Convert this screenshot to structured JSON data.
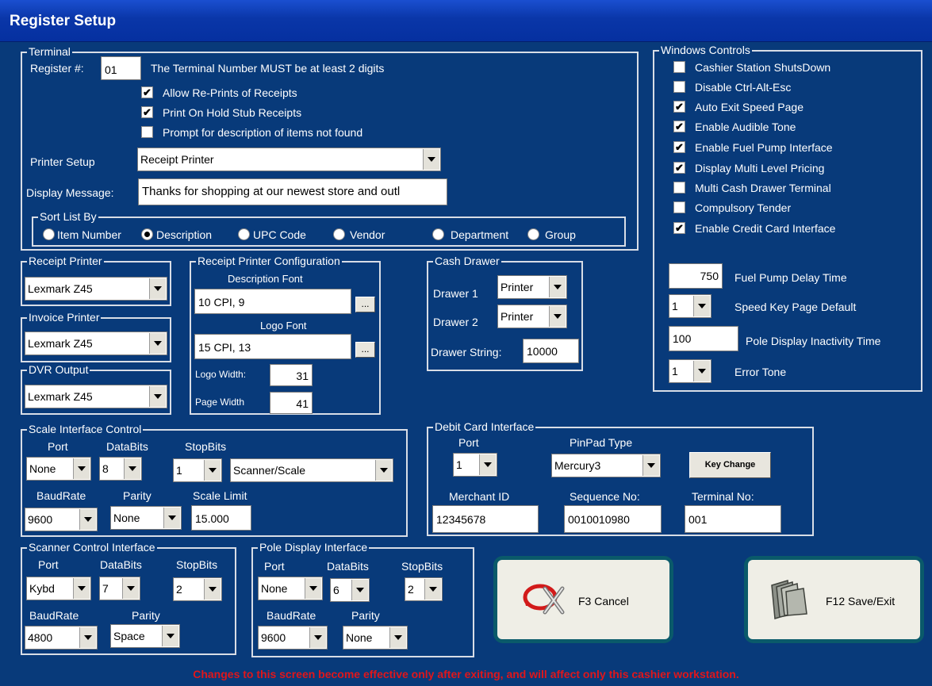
{
  "window": {
    "title": "Register Setup"
  },
  "terminal": {
    "legend": "Terminal",
    "register_label": "Register #:",
    "register_value": "01",
    "register_note": "The Terminal Number MUST be at least 2 digits",
    "options": [
      {
        "label": "Allow Re-Prints of Receipts",
        "checked": true
      },
      {
        "label": "Print On Hold Stub Receipts",
        "checked": true
      },
      {
        "label": "Prompt for description of items not found",
        "checked": false
      }
    ],
    "printer_setup_label": "Printer Setup",
    "printer_setup_value": "Receipt Printer",
    "display_message_label": "Display Message:",
    "display_message_value": "Thanks for shopping at our newest store and outl"
  },
  "sort_list": {
    "legend": "Sort List By",
    "options": [
      "Item Number",
      "Description",
      "UPC Code",
      "Vendor",
      "Department",
      "Group"
    ],
    "selected": "Description"
  },
  "windows_controls": {
    "legend": "Windows Controls",
    "items": [
      {
        "label": "Cashier Station ShutsDown",
        "checked": false
      },
      {
        "label": "Disable Ctrl-Alt-Esc",
        "checked": false
      },
      {
        "label": "Auto Exit Speed Page",
        "checked": true
      },
      {
        "label": "Enable Audible Tone",
        "checked": true
      },
      {
        "label": "Enable Fuel Pump Interface",
        "checked": true
      },
      {
        "label": "Display Multi Level Pricing",
        "checked": true
      },
      {
        "label": "Multi Cash Drawer Terminal",
        "checked": false
      },
      {
        "label": "Compulsory Tender",
        "checked": false
      },
      {
        "label": "Enable Credit Card Interface",
        "checked": true
      }
    ],
    "fuel_delay_value": "750",
    "fuel_delay_label": "Fuel Pump Delay Time",
    "speed_key_value": "1",
    "speed_key_label": "Speed Key Page Default",
    "pole_inactivity_value": "100",
    "pole_inactivity_label": "Pole Display Inactivity Time",
    "error_tone_value": "1",
    "error_tone_label": "Error Tone"
  },
  "receipt_printer": {
    "legend": "Receipt Printer",
    "value": "Lexmark Z45"
  },
  "invoice_printer": {
    "legend": "Invoice Printer",
    "value": "Lexmark Z45"
  },
  "dvr_output": {
    "legend": "DVR Output",
    "value": "Lexmark Z45"
  },
  "rp_config": {
    "legend": "Receipt Printer Configuration",
    "desc_font_label": "Description Font",
    "desc_font_value": "10 CPI, 9",
    "logo_font_label": "Logo Font",
    "logo_font_value": "15 CPI, 13",
    "browse": "...",
    "logo_width_label": "Logo Width:",
    "logo_width_value": "31",
    "page_width_label": "Page Width",
    "page_width_value": "41"
  },
  "cash_drawer": {
    "legend": "Cash Drawer",
    "drawer1_label": "Drawer 1",
    "drawer1_value": "Printer",
    "drawer2_label": "Drawer 2",
    "drawer2_value": "Printer",
    "string_label": "Drawer String:",
    "string_value": "10000"
  },
  "scale": {
    "legend": "Scale Interface Control",
    "port_label": "Port",
    "port_value": "None",
    "databits_label": "DataBits",
    "databits_value": "8",
    "stopbits_label": "StopBits",
    "stopbits_value": "1",
    "mode_value": "Scanner/Scale",
    "baud_label": "BaudRate",
    "baud_value": "9600",
    "parity_label": "Parity",
    "parity_value": "None",
    "limit_label": "Scale Limit",
    "limit_value": "15.000"
  },
  "debit": {
    "legend": "Debit Card Interface",
    "port_label": "Port",
    "port_value": "1",
    "pinpad_label": "PinPad Type",
    "pinpad_value": "Mercury3",
    "key_change": "Key Change",
    "merchant_label": "Merchant ID",
    "merchant_value": "12345678",
    "sequence_label": "Sequence No:",
    "sequence_value": "0010010980",
    "terminal_label": "Terminal No:",
    "terminal_value": "001"
  },
  "scanner": {
    "legend": "Scanner Control Interface",
    "port_label": "Port",
    "port_value": "Kybd",
    "databits_label": "DataBits",
    "databits_value": "7",
    "stopbits_label": "StopBits",
    "stopbits_value": "2",
    "baud_label": "BaudRate",
    "baud_value": "4800",
    "parity_label": "Parity",
    "parity_value": "Space"
  },
  "pole": {
    "legend": "Pole Display Interface",
    "port_label": "Port",
    "port_value": "None",
    "databits_label": "DataBits",
    "databits_value": "6",
    "stopbits_label": "StopBits",
    "stopbits_value": "2",
    "baud_label": "BaudRate",
    "baud_value": "9600",
    "parity_label": "Parity",
    "parity_value": "None"
  },
  "actions": {
    "cancel": "F3 Cancel",
    "save": "F12 Save/Exit"
  },
  "footer": "Changes to this screen become effective only after exiting, and will affect only this cashier workstation."
}
